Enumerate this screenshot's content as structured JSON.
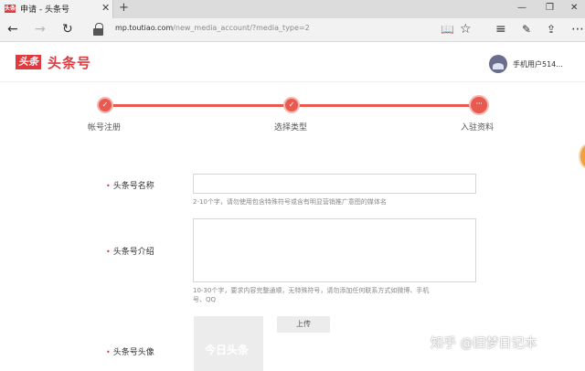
{
  "browser": {
    "tab_title": "申请 - 头条号",
    "favicon_text": "头条",
    "tab_close": "✕",
    "new_tab": "+",
    "window_controls": [
      "—",
      "❐",
      "✕"
    ],
    "url_host": "mp.toutiao.com",
    "url_path": "/new_media_account/?media_type=2",
    "nav_icons": [
      "back-icon",
      "forward-icon",
      "refresh-icon"
    ],
    "toolbar_icons": [
      "reading-view-icon",
      "favorite-star-icon",
      "hub-icon",
      "notes-icon",
      "share-icon",
      "more-icon"
    ]
  },
  "header": {
    "logo_badge": "头条",
    "logo_text": "头条号",
    "user_name": "手机用户514..."
  },
  "steps": [
    {
      "label": "帐号注册",
      "status": "done",
      "glyph": "✓"
    },
    {
      "label": "选择类型",
      "status": "done",
      "glyph": "✓"
    },
    {
      "label": "入驻资料",
      "status": "current",
      "glyph": "···"
    }
  ],
  "form": {
    "name": {
      "label": "头条号名称",
      "value": "",
      "hint": "2-10个字，请勿使用包含特殊符号或含有明显营销推广意图的媒体名"
    },
    "intro": {
      "label": "头条号介绍",
      "value": "",
      "hint_line1": "10-30个字，要求内容完整通顺，无特殊符号，请勿添加任何联系方式如微博、手机",
      "hint_line2": "号、QQ"
    },
    "avatar": {
      "label": "头条号头像",
      "placeholder_text": "今日头条",
      "upload_label": "上传"
    },
    "required_mark": "•"
  },
  "watermark": "知乎 @旧梦日记本",
  "colors": {
    "brand": "#e0393e",
    "step": "#e85a4f"
  }
}
